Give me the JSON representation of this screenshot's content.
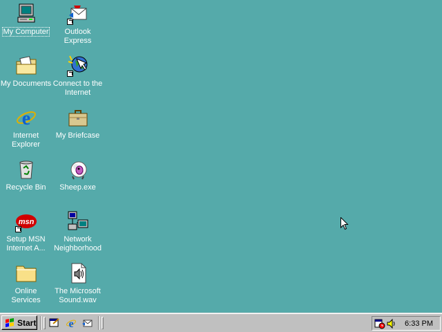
{
  "desktop": {
    "background_color": "#55aaaa",
    "icons": [
      {
        "label": "My Computer",
        "icon": "my-computer-icon",
        "selected": true
      },
      {
        "label": "Outlook\nExpress",
        "icon": "outlook-express-icon"
      },
      {
        "label": "My Documents",
        "icon": "my-documents-icon"
      },
      {
        "label": "Connect to the\nInternet",
        "icon": "connect-internet-icon"
      },
      {
        "label": "Internet\nExplorer",
        "icon": "internet-explorer-icon"
      },
      {
        "label": "My Briefcase",
        "icon": "briefcase-icon"
      },
      {
        "label": "Recycle Bin",
        "icon": "recycle-bin-icon"
      },
      {
        "label": "Sheep.exe",
        "icon": "sheep-icon"
      },
      {
        "label": "Setup MSN\nInternet A...",
        "icon": "msn-icon"
      },
      {
        "label": "Network\nNeighborhood",
        "icon": "network-icon"
      },
      {
        "label": "Online\nServices",
        "icon": "folder-icon"
      },
      {
        "label": "The Microsoft\nSound.wav",
        "icon": "sound-file-icon"
      }
    ]
  },
  "taskbar": {
    "start_label": "Start",
    "quick_launch": [
      "show-desktop-icon",
      "internet-explorer-icon",
      "outlook-express-icon"
    ],
    "tray_icons": [
      "scheduler-icon",
      "volume-icon"
    ],
    "clock": "6:33 PM"
  }
}
